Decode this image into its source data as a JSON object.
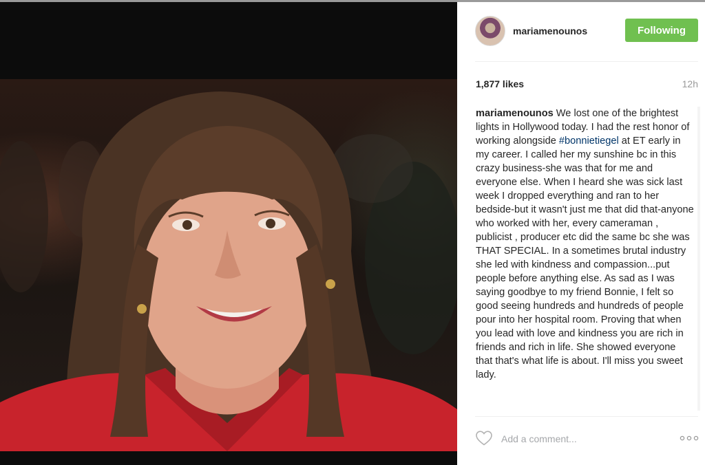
{
  "post": {
    "photo_alt": "Woman with brown hair and bangs wearing a red jacket, smiling"
  },
  "header": {
    "username": "mariamenounos",
    "follow_label": "Following",
    "avatar_icon": "profile-avatar"
  },
  "stats": {
    "likes": "1,877 likes",
    "time": "12h"
  },
  "caption": {
    "username": "mariamenounos",
    "text_before_tag": " We lost one of the brightest lights in Hollywood today. I had the rest honor of working alongside ",
    "hashtag": "#bonnietiegel",
    "text_after_tag": " at ET early in my career. I called her my sunshine bc in this crazy business-she was that for me and everyone else. When I heard she was sick last week I dropped everything and ran to her bedside-but it wasn't just me that did that-anyone who worked with her, every cameraman , publicist , producer etc did the same bc she was THAT SPECIAL. In a sometimes brutal industry she led with kindness and compassion...put people before anything else. As sad as I was saying goodbye to my friend Bonnie, I felt so good seeing hundreds and hundreds of people pour into her hospital room. Proving that when you lead with love and kindness you are rich in friends and rich in life. She showed everyone that that's what life is about. I'll miss you sweet lady."
  },
  "footer": {
    "comment_placeholder": "Add a comment...",
    "like_icon": "heart-outline",
    "more_icon": "more-horizontal"
  },
  "colors": {
    "follow_green": "#70c050",
    "hashtag_blue": "#003569",
    "text_dark": "#262626",
    "muted_gray": "#999999"
  }
}
